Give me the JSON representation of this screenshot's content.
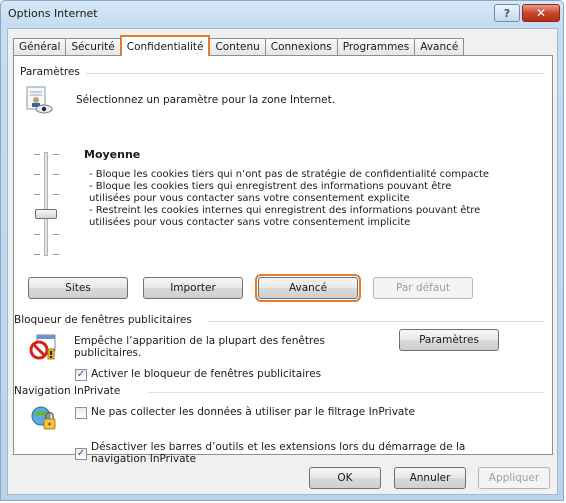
{
  "window": {
    "title": "Options Internet",
    "help_glyph": "?",
    "close_glyph": "✕"
  },
  "tabs": [
    {
      "label": "Général"
    },
    {
      "label": "Sécurité"
    },
    {
      "label": "Confidentialité"
    },
    {
      "label": "Contenu"
    },
    {
      "label": "Connexions"
    },
    {
      "label": "Programmes"
    },
    {
      "label": "Avancé"
    }
  ],
  "active_tab": "Confidentialité",
  "settings": {
    "group_label": "Paramètres",
    "intro": "Sélectionnez un paramètre pour la zone Internet.",
    "level": "Moyenne",
    "description": "- Bloque les cookies tiers qui n’ont pas de stratégie de confidentialité compacte\n- Bloque les cookies tiers qui enregistrent des informations pouvant être utilisées pour vous contacter sans votre consentement explicite\n- Restreint les cookies internes qui enregistrent des informations pouvant être utilisées pour vous contacter sans votre consentement implicite",
    "buttons": {
      "sites": "Sites",
      "import": "Importer",
      "advanced": "Avancé",
      "default": "Par défaut"
    }
  },
  "popup_blocker": {
    "group_label": "Bloqueur de fenêtres publicitaires",
    "description": "Empêche l’apparition de la plupart des fenêtres publicitaires.",
    "settings_button": "Paramètres",
    "enable_label": "Activer le bloqueur de fenêtres publicitaires",
    "enable_checked": true
  },
  "inprivate": {
    "group_label": "Navigation InPrivate",
    "no_collect_label": "Ne pas collecter les données à utiliser par le filtrage InPrivate",
    "no_collect_checked": false,
    "disable_toolbars_label": "Désactiver les barres d’outils et les extensions lors du démarrage de la navigation InPrivate",
    "disable_toolbars_checked": true
  },
  "footer": {
    "ok": "OK",
    "cancel": "Annuler",
    "apply": "Appliquer"
  },
  "colors": {
    "highlight": "#e87b2a"
  }
}
